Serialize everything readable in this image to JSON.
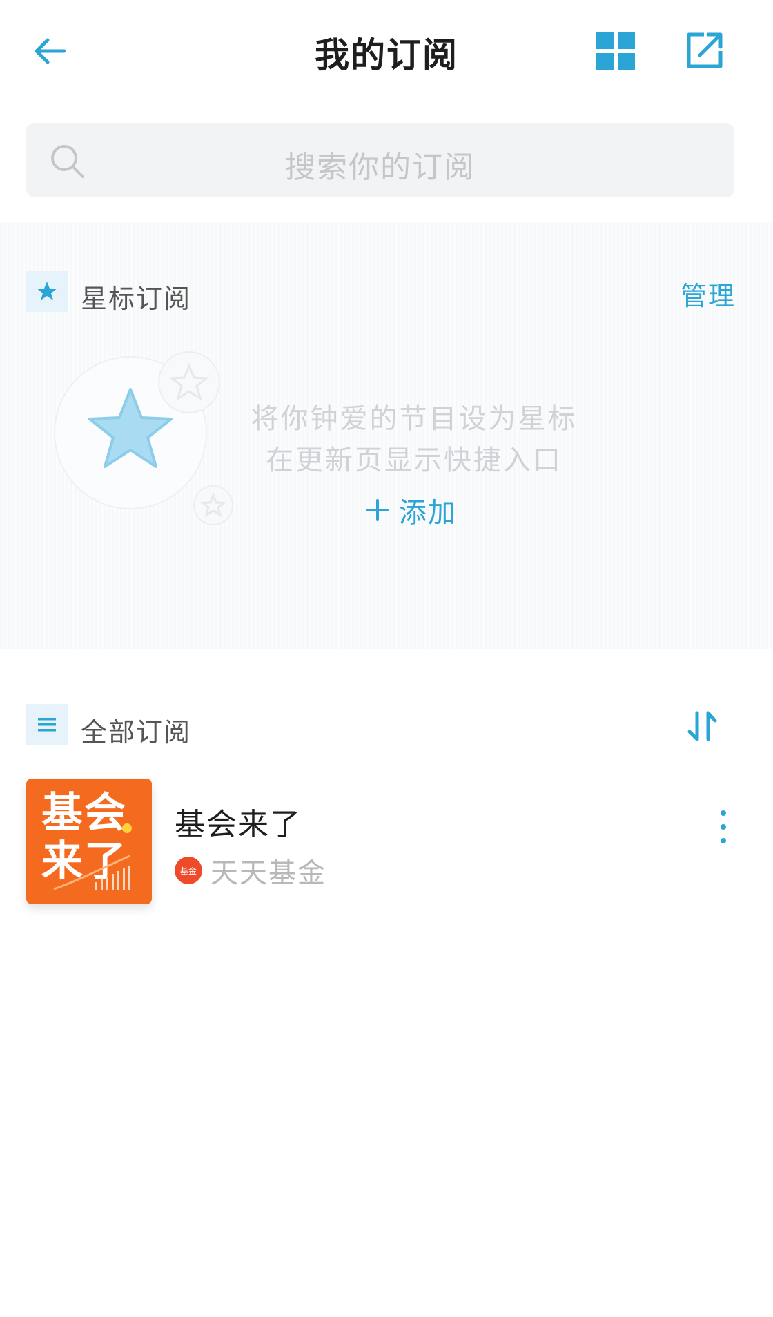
{
  "header": {
    "title": "我的订阅"
  },
  "search": {
    "placeholder": "搜索你的订阅"
  },
  "starred": {
    "label": "星标订阅",
    "manage_label": "管理",
    "empty_line1": "将你钟爱的节目设为星标",
    "empty_line2": "在更新页显示快捷入口",
    "add_label": "添加"
  },
  "all": {
    "label": "全部订阅",
    "items": [
      {
        "title": "基会来了",
        "cover_line1": "基会",
        "cover_line2": "来了",
        "author": "天天基金",
        "author_logo_text": "基金"
      }
    ]
  },
  "colors": {
    "accent": "#2ba4d6",
    "cover": "#f46a1f",
    "author_logo": "#ef4b2a"
  }
}
